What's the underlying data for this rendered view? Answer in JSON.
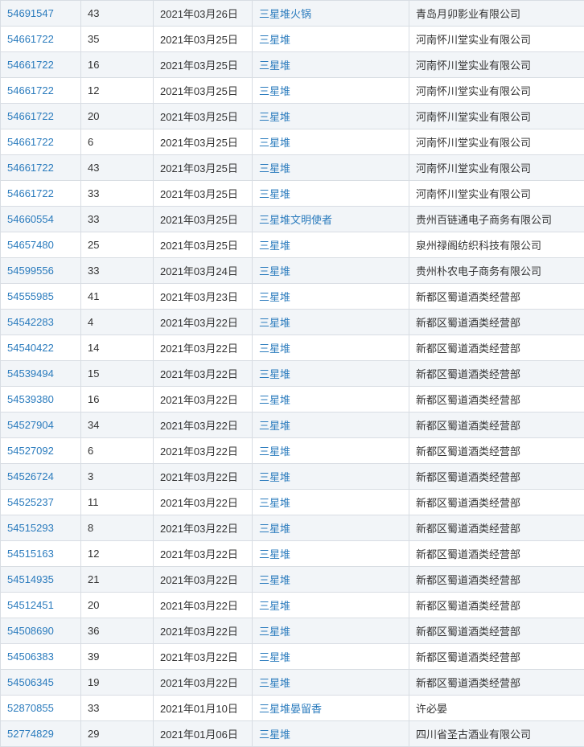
{
  "rows": [
    {
      "id": "54691547",
      "cls": "43",
      "date": "2021年03月26日",
      "name": "三星堆火锅",
      "applicant": "青岛月卯影业有限公司"
    },
    {
      "id": "54661722",
      "cls": "35",
      "date": "2021年03月25日",
      "name": "三星堆",
      "applicant": "河南怀川堂实业有限公司"
    },
    {
      "id": "54661722",
      "cls": "16",
      "date": "2021年03月25日",
      "name": "三星堆",
      "applicant": "河南怀川堂实业有限公司"
    },
    {
      "id": "54661722",
      "cls": "12",
      "date": "2021年03月25日",
      "name": "三星堆",
      "applicant": "河南怀川堂实业有限公司"
    },
    {
      "id": "54661722",
      "cls": "20",
      "date": "2021年03月25日",
      "name": "三星堆",
      "applicant": "河南怀川堂实业有限公司"
    },
    {
      "id": "54661722",
      "cls": "6",
      "date": "2021年03月25日",
      "name": "三星堆",
      "applicant": "河南怀川堂实业有限公司"
    },
    {
      "id": "54661722",
      "cls": "43",
      "date": "2021年03月25日",
      "name": "三星堆",
      "applicant": "河南怀川堂实业有限公司"
    },
    {
      "id": "54661722",
      "cls": "33",
      "date": "2021年03月25日",
      "name": "三星堆",
      "applicant": "河南怀川堂实业有限公司"
    },
    {
      "id": "54660554",
      "cls": "33",
      "date": "2021年03月25日",
      "name": "三星堆文明使者",
      "applicant": "贵州百链通电子商务有限公司"
    },
    {
      "id": "54657480",
      "cls": "25",
      "date": "2021年03月25日",
      "name": "三星堆",
      "applicant": "泉州禄阁纺织科技有限公司"
    },
    {
      "id": "54599556",
      "cls": "33",
      "date": "2021年03月24日",
      "name": "三星堆",
      "applicant": "贵州朴农电子商务有限公司"
    },
    {
      "id": "54555985",
      "cls": "41",
      "date": "2021年03月23日",
      "name": "三星堆",
      "applicant": "新都区蜀道酒类经营部"
    },
    {
      "id": "54542283",
      "cls": "4",
      "date": "2021年03月22日",
      "name": "三星堆",
      "applicant": "新都区蜀道酒类经营部"
    },
    {
      "id": "54540422",
      "cls": "14",
      "date": "2021年03月22日",
      "name": "三星堆",
      "applicant": "新都区蜀道酒类经营部"
    },
    {
      "id": "54539494",
      "cls": "15",
      "date": "2021年03月22日",
      "name": "三星堆",
      "applicant": "新都区蜀道酒类经营部"
    },
    {
      "id": "54539380",
      "cls": "16",
      "date": "2021年03月22日",
      "name": "三星堆",
      "applicant": "新都区蜀道酒类经营部"
    },
    {
      "id": "54527904",
      "cls": "34",
      "date": "2021年03月22日",
      "name": "三星堆",
      "applicant": "新都区蜀道酒类经营部"
    },
    {
      "id": "54527092",
      "cls": "6",
      "date": "2021年03月22日",
      "name": "三星堆",
      "applicant": "新都区蜀道酒类经营部"
    },
    {
      "id": "54526724",
      "cls": "3",
      "date": "2021年03月22日",
      "name": "三星堆",
      "applicant": "新都区蜀道酒类经营部"
    },
    {
      "id": "54525237",
      "cls": "11",
      "date": "2021年03月22日",
      "name": "三星堆",
      "applicant": "新都区蜀道酒类经营部"
    },
    {
      "id": "54515293",
      "cls": "8",
      "date": "2021年03月22日",
      "name": "三星堆",
      "applicant": "新都区蜀道酒类经营部"
    },
    {
      "id": "54515163",
      "cls": "12",
      "date": "2021年03月22日",
      "name": "三星堆",
      "applicant": "新都区蜀道酒类经营部"
    },
    {
      "id": "54514935",
      "cls": "21",
      "date": "2021年03月22日",
      "name": "三星堆",
      "applicant": "新都区蜀道酒类经营部"
    },
    {
      "id": "54512451",
      "cls": "20",
      "date": "2021年03月22日",
      "name": "三星堆",
      "applicant": "新都区蜀道酒类经营部"
    },
    {
      "id": "54508690",
      "cls": "36",
      "date": "2021年03月22日",
      "name": "三星堆",
      "applicant": "新都区蜀道酒类经营部"
    },
    {
      "id": "54506383",
      "cls": "39",
      "date": "2021年03月22日",
      "name": "三星堆",
      "applicant": "新都区蜀道酒类经营部"
    },
    {
      "id": "54506345",
      "cls": "19",
      "date": "2021年03月22日",
      "name": "三星堆",
      "applicant": "新都区蜀道酒类经营部"
    },
    {
      "id": "52870855",
      "cls": "33",
      "date": "2021年01月10日",
      "name": "三星堆晏留香",
      "applicant": "许必晏"
    },
    {
      "id": "52774829",
      "cls": "29",
      "date": "2021年01月06日",
      "name": "三星堆",
      "applicant": "四川省圣古酒业有限公司"
    }
  ]
}
